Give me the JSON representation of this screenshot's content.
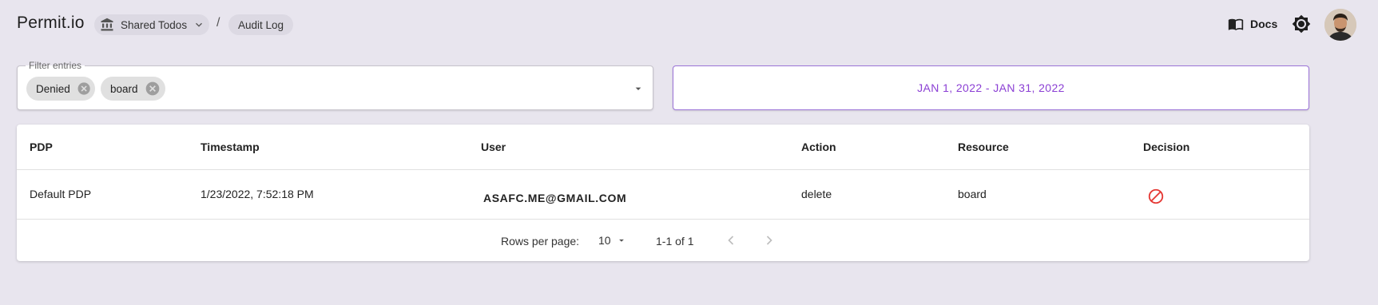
{
  "app": {
    "logo": "Permit.io"
  },
  "breadcrumb": {
    "project": "Shared Todos",
    "separator": "/",
    "page": "Audit Log"
  },
  "header": {
    "docs_label": "Docs"
  },
  "filter": {
    "legend": "Filter entries",
    "chips": [
      {
        "label": "Denied"
      },
      {
        "label": "board"
      }
    ]
  },
  "daterange": {
    "label": "JAN 1, 2022 - JAN 31, 2022"
  },
  "table": {
    "columns": [
      "PDP",
      "Timestamp",
      "User",
      "Action",
      "Resource",
      "Decision"
    ],
    "rows": [
      {
        "pdp": "Default PDP",
        "timestamp": "1/23/2022, 7:52:18 PM",
        "user": "ASAFC.ME@GMAIL.COM",
        "action": "delete",
        "resource": "board",
        "decision_icon": "denied-icon"
      }
    ]
  },
  "pagination": {
    "rows_per_page_label": "Rows per page:",
    "rows_per_page": "10",
    "range": "1-1 of 1"
  },
  "colors": {
    "background": "#e8e5ee",
    "accent": "#8b3fd4",
    "denied": "#e53935"
  },
  "icons": [
    "bank-icon",
    "chevron-down-icon",
    "book-icon",
    "settings-icon",
    "cancel-icon",
    "arrow-drop-down-icon",
    "denied-icon",
    "chevron-left-icon",
    "chevron-right-icon"
  ]
}
